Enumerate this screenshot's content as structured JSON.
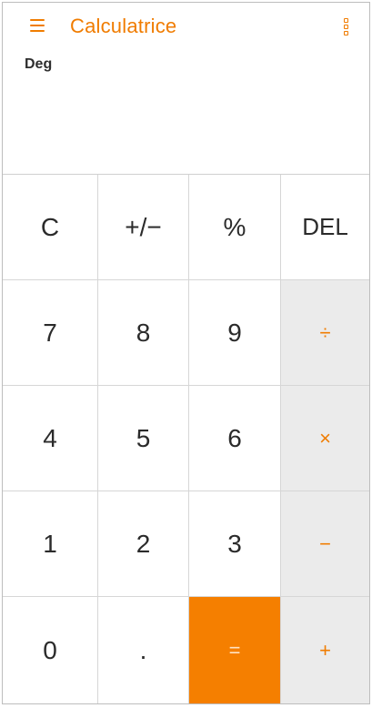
{
  "app_bar": {
    "menu_icon": "hamburger-menu-icon",
    "title": "Calculatrice",
    "overflow_icon": "more-vertical-icon"
  },
  "display": {
    "mode": "Deg",
    "value": ""
  },
  "keypad": {
    "rows": [
      [
        {
          "name": "clear-button",
          "label": "C",
          "type": "function"
        },
        {
          "name": "sign-toggle-button",
          "label": "+/−",
          "type": "function"
        },
        {
          "name": "percent-button",
          "label": "%",
          "type": "function"
        },
        {
          "name": "delete-button",
          "label": "DEL",
          "type": "function"
        }
      ],
      [
        {
          "name": "digit-7-button",
          "label": "7",
          "type": "digit"
        },
        {
          "name": "digit-8-button",
          "label": "8",
          "type": "digit"
        },
        {
          "name": "digit-9-button",
          "label": "9",
          "type": "digit"
        },
        {
          "name": "divide-button",
          "label": "÷",
          "type": "operator"
        }
      ],
      [
        {
          "name": "digit-4-button",
          "label": "4",
          "type": "digit"
        },
        {
          "name": "digit-5-button",
          "label": "5",
          "type": "digit"
        },
        {
          "name": "digit-6-button",
          "label": "6",
          "type": "digit"
        },
        {
          "name": "multiply-button",
          "label": "×",
          "type": "operator"
        }
      ],
      [
        {
          "name": "digit-1-button",
          "label": "1",
          "type": "digit"
        },
        {
          "name": "digit-2-button",
          "label": "2",
          "type": "digit"
        },
        {
          "name": "digit-3-button",
          "label": "3",
          "type": "digit"
        },
        {
          "name": "subtract-button",
          "label": "−",
          "type": "operator"
        }
      ],
      [
        {
          "name": "digit-0-button",
          "label": "0",
          "type": "digit"
        },
        {
          "name": "decimal-point-button",
          "label": ".",
          "type": "digit"
        },
        {
          "name": "equals-button",
          "label": "=",
          "type": "equals"
        },
        {
          "name": "add-button",
          "label": "+",
          "type": "operator"
        }
      ]
    ]
  },
  "colors": {
    "accent": "#f07c00",
    "equals_bg": "#f57f00",
    "operator_bg": "#ebebeb",
    "text": "#2b2b2b"
  }
}
